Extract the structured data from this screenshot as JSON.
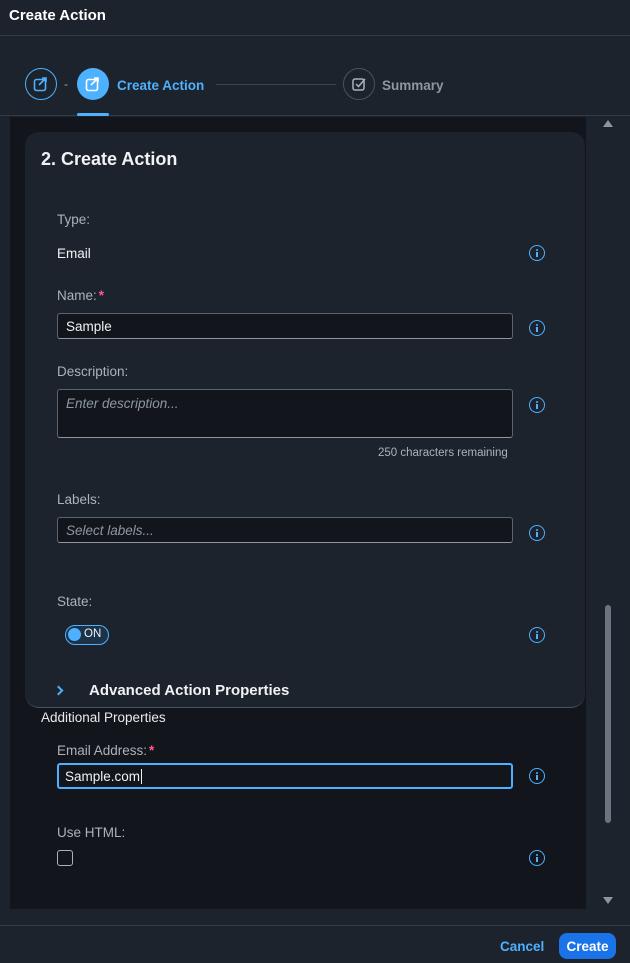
{
  "dialog": {
    "title": "Create Action"
  },
  "wizard": {
    "separator": "-",
    "steps": [
      {
        "label": "",
        "icon": "share-icon",
        "state": "done"
      },
      {
        "label": "Create Action",
        "icon": "share-icon",
        "state": "active"
      },
      {
        "label": "Summary",
        "icon": "checkbox-icon",
        "state": "inactive"
      }
    ]
  },
  "form": {
    "section_title": "2. Create Action",
    "type": {
      "label": "Type:",
      "value": "Email"
    },
    "name": {
      "label": "Name:",
      "required_mark": "*",
      "value": "Sample"
    },
    "description": {
      "label": "Description:",
      "placeholder": "Enter description...",
      "counter": "250 characters remaining"
    },
    "labels": {
      "label": "Labels:",
      "placeholder": "Select labels..."
    },
    "state": {
      "label": "State:",
      "toggle_text": "ON"
    },
    "advanced": {
      "title": "Advanced Action Properties"
    },
    "additional": {
      "heading": "Additional Properties"
    },
    "email": {
      "label": "Email Address:",
      "required_mark": "*",
      "value": "Sample.com"
    },
    "use_html": {
      "label": "Use HTML:"
    }
  },
  "footer": {
    "cancel_label": "Cancel",
    "create_label": "Create"
  },
  "colors": {
    "accent": "#4db1ff",
    "primary_button": "#1a73e8",
    "required": "#ff5c8a",
    "background": "#1d232c"
  }
}
